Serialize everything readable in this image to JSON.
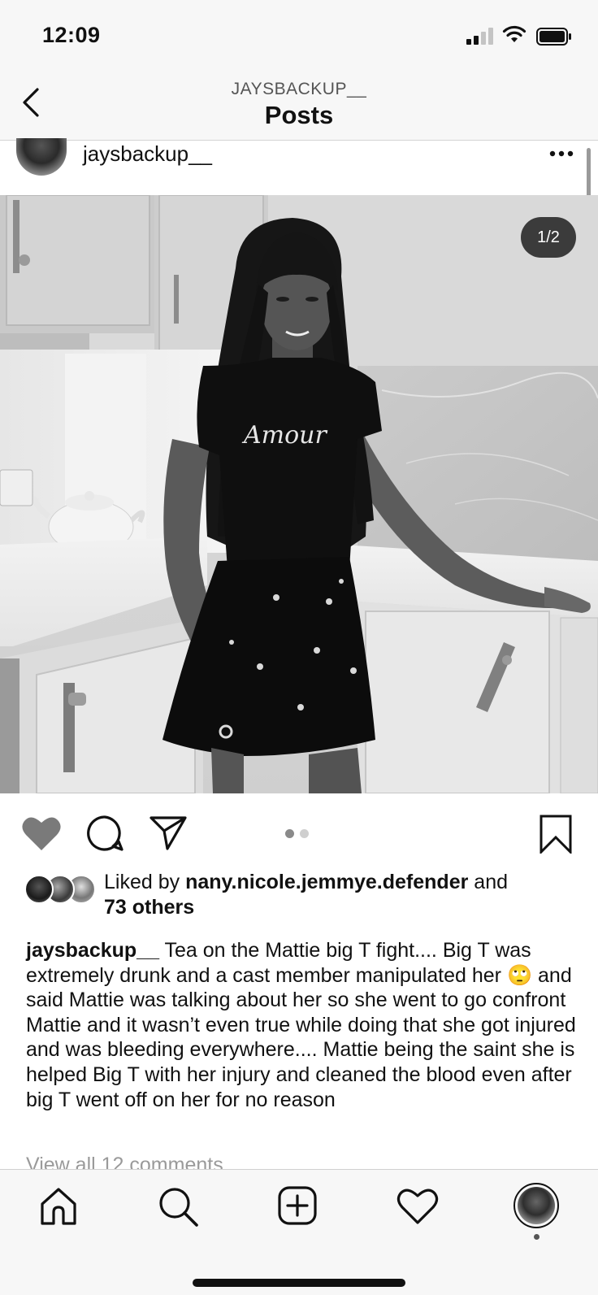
{
  "status_bar": {
    "time": "12:09"
  },
  "header": {
    "subtitle": "JAYSBACKUP__",
    "title": "Posts"
  },
  "post": {
    "username": "jaysbackup__",
    "image_counter": "1/2",
    "shirt_text": "Amour",
    "likes": {
      "prefix": "Liked by ",
      "user": "nany.nicole.jemmye.defender",
      "middle": " and",
      "others": "73 others"
    },
    "caption_user": "jaysbackup__",
    "caption_text": " Tea on the Mattie big T fight.... Big T was extremely drunk and a cast member manipulated her 🙄 and said Mattie was talking about her so she went to go confront Mattie and it wasn’t even true while doing that she got injured and was bleeding everywhere.... Mattie being the saint she is helped Big T with her injury and cleaned the blood even after big T went off on her for no reason",
    "view_comments": "View all 12 comments"
  },
  "icons": {
    "back": "chevron-left-icon",
    "more": "more-dots-icon",
    "like": "heart-filled-icon",
    "comment": "comment-bubble-icon",
    "share": "paper-plane-icon",
    "save": "bookmark-icon",
    "tabs": [
      "home-icon",
      "search-icon",
      "add-post-icon",
      "heart-outline-icon",
      "profile-avatar-icon"
    ]
  },
  "colors": {
    "background": "#ffffff",
    "bars": "#f7f7f7",
    "text": "#111111",
    "muted": "#9a9a9a"
  }
}
